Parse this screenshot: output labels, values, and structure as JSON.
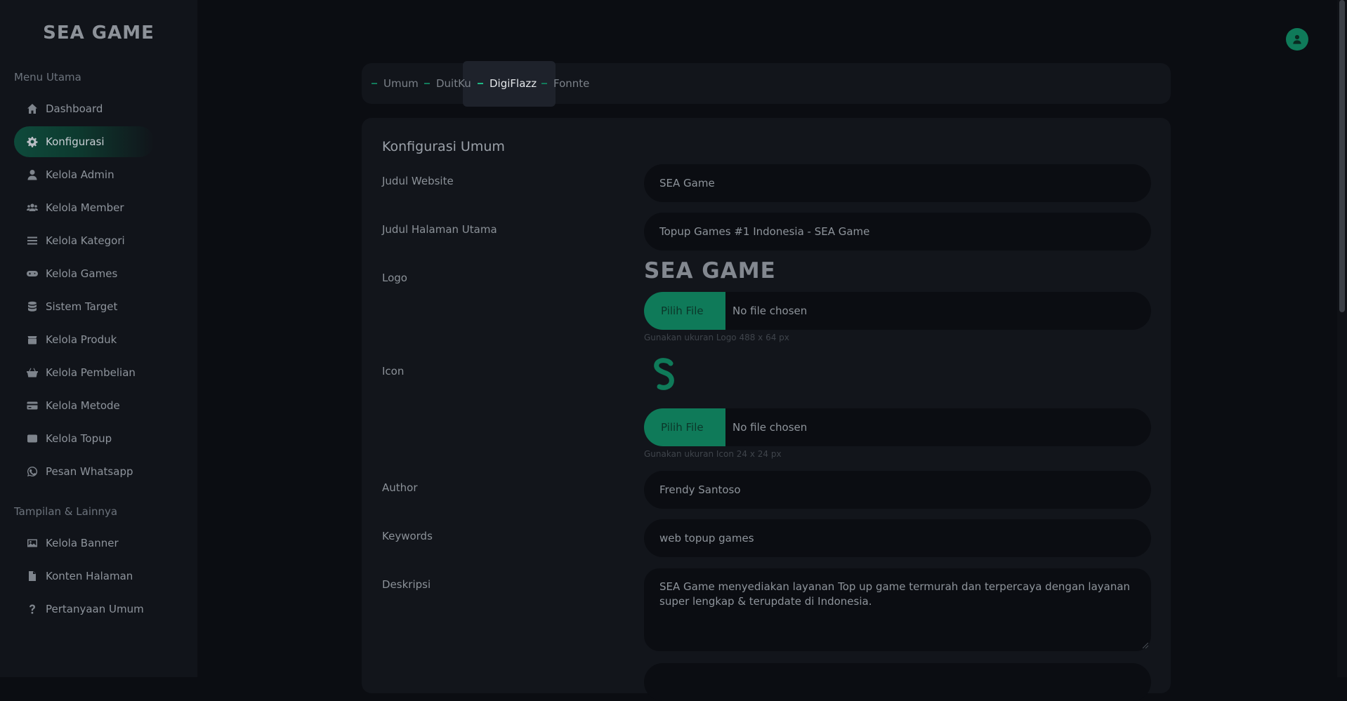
{
  "brand": "SEA GAME",
  "sidebar": {
    "section_main": "Menu Utama",
    "section_other": "Tampilan & Lainnya",
    "main_items": [
      {
        "label": "Dashboard",
        "icon": "home-icon"
      },
      {
        "label": "Konfigurasi",
        "icon": "gear-icon"
      },
      {
        "label": "Kelola Admin",
        "icon": "user-icon"
      },
      {
        "label": "Kelola Member",
        "icon": "users-icon"
      },
      {
        "label": "Kelola Kategori",
        "icon": "list-icon"
      },
      {
        "label": "Kelola Games",
        "icon": "gamepad-icon"
      },
      {
        "label": "Sistem Target",
        "icon": "database-icon"
      },
      {
        "label": "Kelola Produk",
        "icon": "box-icon"
      },
      {
        "label": "Kelola Pembelian",
        "icon": "basket-icon"
      },
      {
        "label": "Kelola Metode",
        "icon": "card-icon"
      },
      {
        "label": "Kelola Topup",
        "icon": "wallet-icon"
      },
      {
        "label": "Pesan Whatsapp",
        "icon": "whatsapp-icon"
      }
    ],
    "other_items": [
      {
        "label": "Kelola Banner",
        "icon": "image-icon"
      },
      {
        "label": "Konten Halaman",
        "icon": "file-icon"
      },
      {
        "label": "Pertanyaan Umum",
        "icon": "question-icon"
      }
    ]
  },
  "tabs": [
    {
      "label": "Umum"
    },
    {
      "label": "DuitKu"
    },
    {
      "label": "DigiFlazz"
    },
    {
      "label": "Fonnte"
    }
  ],
  "form": {
    "title": "Konfigurasi Umum",
    "judul_website_label": "Judul Website",
    "judul_website_value": "SEA Game",
    "judul_halaman_label": "Judul Halaman Utama",
    "judul_halaman_value": "Topup Games #1 Indonesia - SEA Game",
    "logo_label": "Logo",
    "logo_preview": "SEA GAME",
    "logo_button": "Pilih File",
    "logo_file": "No file chosen",
    "logo_hint": "Gunakan ukuran Logo 488 x 64 px",
    "icon_label": "Icon",
    "icon_button": "Pilih File",
    "icon_file": "No file chosen",
    "icon_hint": "Gunakan ukuran Icon 24 x 24 px",
    "author_label": "Author",
    "author_value": "Frendy Santoso",
    "keywords_label": "Keywords",
    "keywords_value": "web topup games",
    "deskripsi_label": "Deskripsi",
    "deskripsi_value": "SEA Game menyediakan layanan Top up game  termurah dan terpercaya  dengan layanan super lengkap & terupdate di Indonesia."
  },
  "colors": {
    "accent": "#0f7a59",
    "background": "#0b0d12",
    "panel": "#12151b",
    "sidebar": "#11141a"
  }
}
